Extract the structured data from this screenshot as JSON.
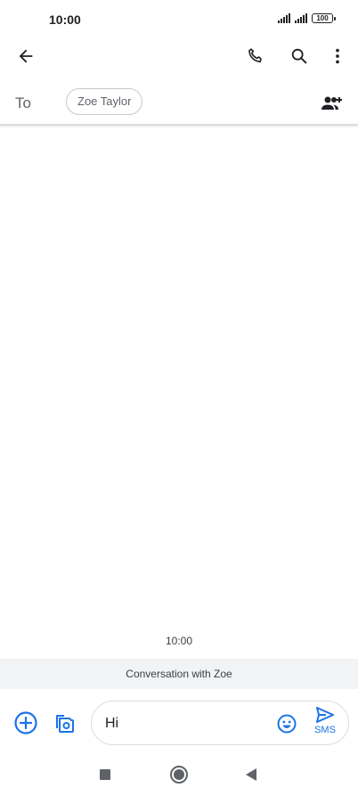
{
  "status_bar": {
    "time": "10:00",
    "battery": "100"
  },
  "toolbar": {
    "back_icon": "arrow-back-icon",
    "call_icon": "phone-icon",
    "search_icon": "search-icon",
    "more_icon": "more-vert-icon"
  },
  "recipients": {
    "to_label": "To",
    "chips": [
      "Zoe Taylor"
    ],
    "add_icon": "add-person-icon"
  },
  "conversation": {
    "timestamp": "10:00",
    "banner": "Conversation with Zoe"
  },
  "compose": {
    "value": "Hi",
    "send_label": "SMS",
    "accent_color": "#1a73e8"
  },
  "nav_bar": {
    "recents_icon": "square-icon",
    "home_icon": "circle-icon",
    "back_icon": "triangle-back-icon"
  }
}
